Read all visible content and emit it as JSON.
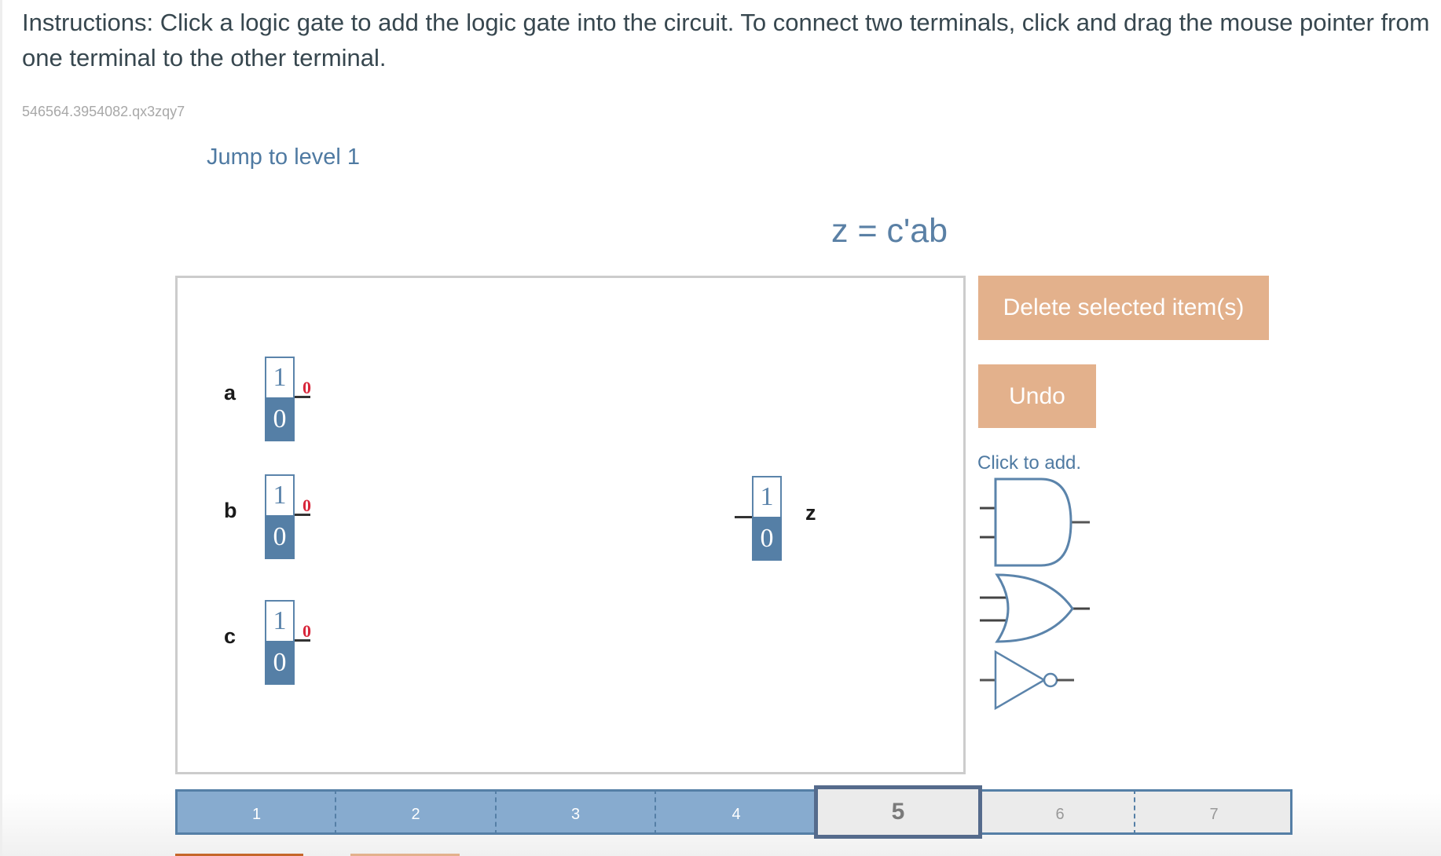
{
  "instructions": "Instructions: Click a logic gate to add the logic gate into the circuit. To connect two terminals, click and drag the mouse pointer from one terminal to the other terminal.",
  "puzzle_id": "546564.3954082.qx3zqy7",
  "jump_link": "Jump to level 1",
  "expression": "z = c'ab",
  "inputs": [
    {
      "name": "a",
      "toggle_high": "1",
      "toggle_low": "0",
      "output_value": "0"
    },
    {
      "name": "b",
      "toggle_high": "1",
      "toggle_low": "0",
      "output_value": "0"
    },
    {
      "name": "c",
      "toggle_high": "1",
      "toggle_low": "0",
      "output_value": "0"
    }
  ],
  "output": {
    "name": "z",
    "display_high": "1",
    "display_low": "0"
  },
  "buttons": {
    "delete": "Delete selected item(s)",
    "undo": "Undo"
  },
  "palette": {
    "label": "Click to add.",
    "gates": [
      "and-gate",
      "or-gate",
      "not-gate"
    ]
  },
  "levels": {
    "items": [
      "1",
      "2",
      "3",
      "4",
      "5",
      "6",
      "7"
    ],
    "completed": 4,
    "current": "5"
  },
  "colors": {
    "accent_blue": "#557fa6",
    "button_orange": "#e3b18c",
    "level_done": "#87abcf",
    "output_red": "#d8263a"
  }
}
